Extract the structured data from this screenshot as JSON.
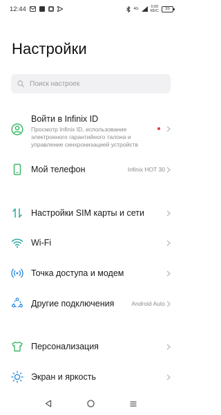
{
  "status": {
    "time": "12:44",
    "net_top": "4G",
    "net_bottom": "",
    "speed_top": "0,00",
    "speed_bottom": "КБ/С",
    "battery": "35"
  },
  "title": "Настройки",
  "search": {
    "placeholder": "Поиск настроек"
  },
  "account": {
    "label": "Войти в Infinix ID",
    "description": "Просмотр Infinix ID, использование электронного гарантийного талона и управление синхронизацией устройств"
  },
  "items": [
    {
      "label": "Мой телефон",
      "value": "Infinix HOT 30",
      "icon": "phone-icon"
    },
    {
      "label": "Настройки SIM карты и сети",
      "value": "",
      "icon": "sim-network-icon"
    },
    {
      "label": "Wi-Fi",
      "value": "",
      "icon": "wifi-icon"
    },
    {
      "label": "Точка доступа и модем",
      "value": "",
      "icon": "hotspot-icon"
    },
    {
      "label": "Другие подключения",
      "value": "Android Auto",
      "icon": "connections-icon"
    },
    {
      "label": "Персонализация",
      "value": "",
      "icon": "shirt-icon"
    },
    {
      "label": "Экран и яркость",
      "value": "",
      "icon": "brightness-icon"
    }
  ],
  "colors": {
    "green": "#3db96b",
    "teal": "#2ba9a0",
    "blue": "#2f8fe0",
    "red_dot": "#e53935"
  }
}
